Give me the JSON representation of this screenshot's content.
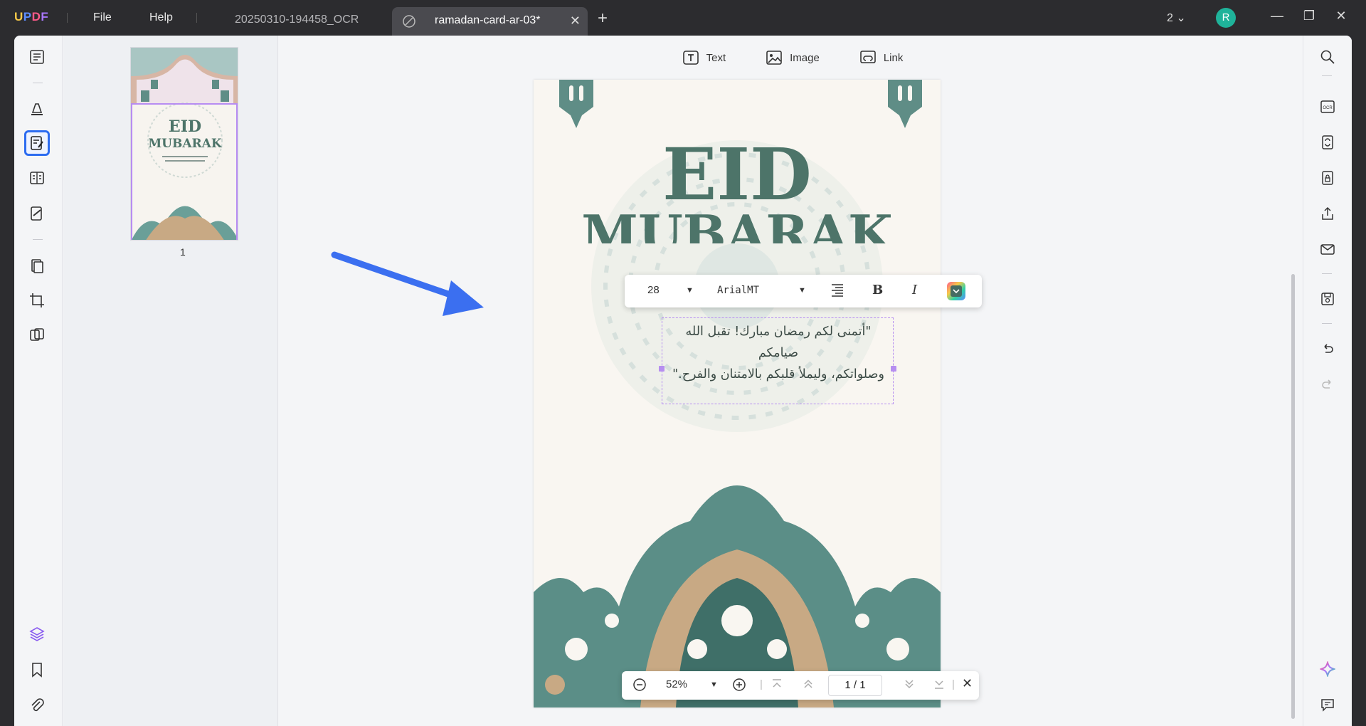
{
  "app": {
    "logo": "UPDF"
  },
  "menu": {
    "file": "File",
    "help": "Help"
  },
  "tabs": [
    {
      "label": "20250310-194458_OCR"
    },
    {
      "label": "ramadan-card-ar-03*"
    }
  ],
  "titlebar": {
    "page_count": "2",
    "avatar_letter": "R"
  },
  "edit_toolbar": {
    "text": "Text",
    "image": "Image",
    "link": "Link"
  },
  "thumbnail": {
    "page_number": "1",
    "title_line1": "EID",
    "title_line2": "MUBARAK"
  },
  "document": {
    "title_line1": "EID",
    "title_line2": "MUBARAK",
    "arabic_line1": "\"أتمنى لكم رمضان مبارك! تقبل الله صيامكم",
    "arabic_line2": "وصلواتكم، وليملأ قلبكم بالامتنان والفرح.\""
  },
  "text_toolbar": {
    "font_size": "28",
    "font_name": "ArialMT",
    "bold": "B",
    "italic": "I"
  },
  "bottombar": {
    "zoom": "52%",
    "page_indicator": "1 / 1"
  },
  "colors": {
    "accent": "#2c6cf0",
    "selection": "#b68ef0",
    "teal": "#4d7469",
    "arrow": "#3b6ff0"
  }
}
